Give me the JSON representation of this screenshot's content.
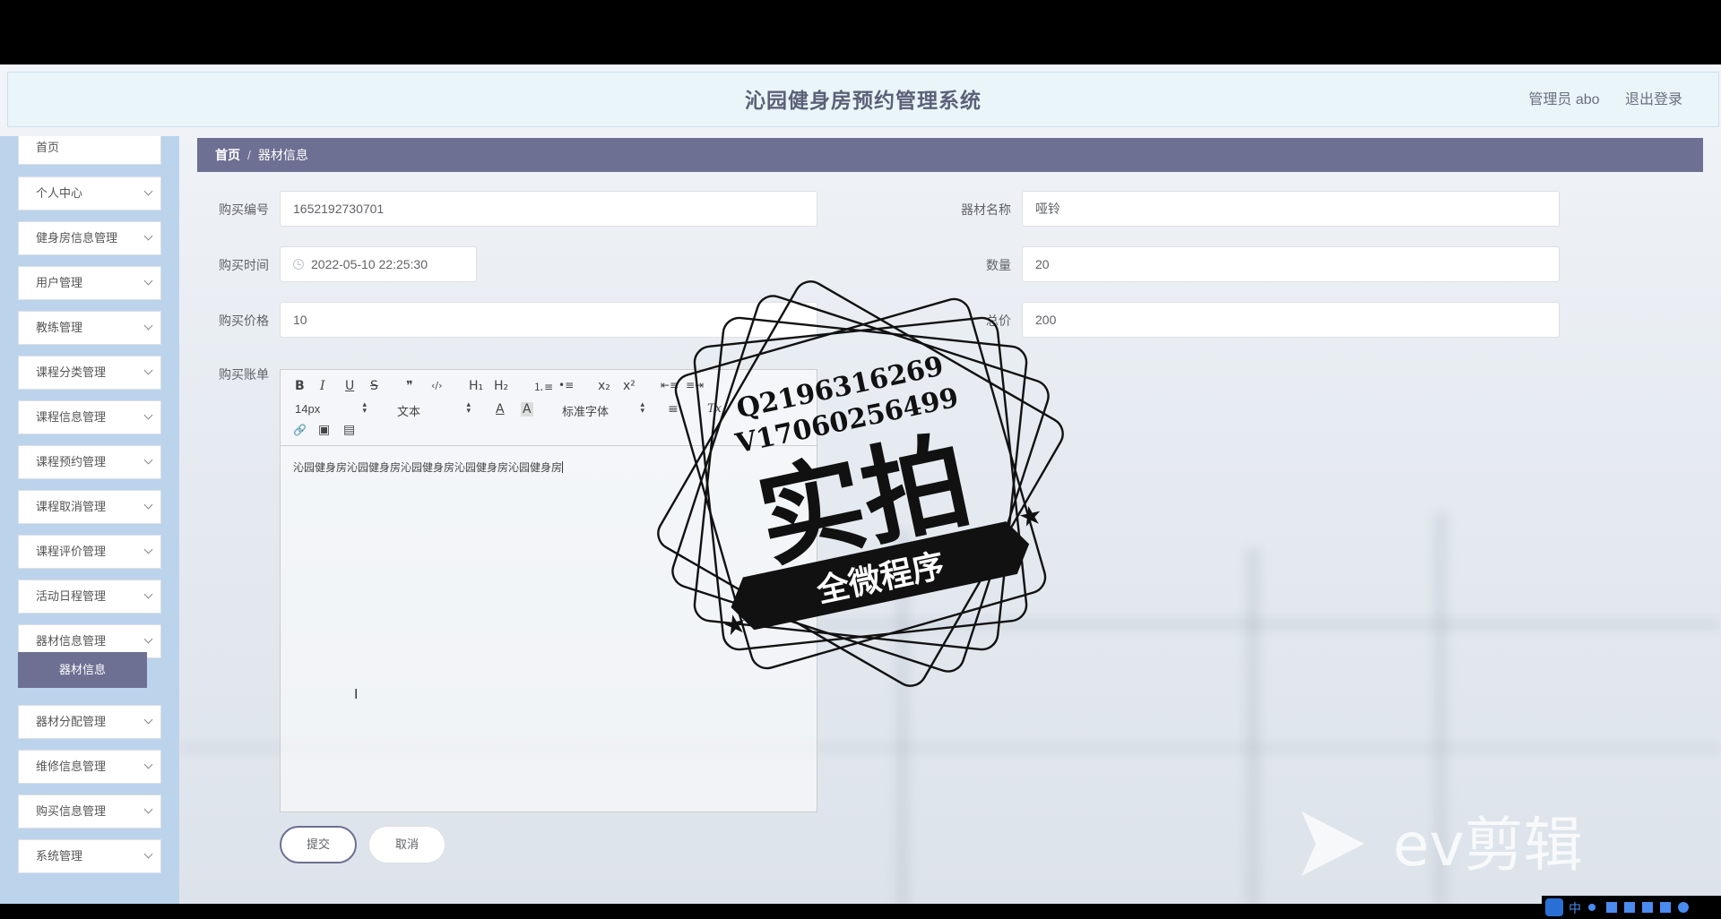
{
  "header": {
    "title": "沁园健身房预约管理系统",
    "user": "管理员 abo",
    "logout": "退出登录"
  },
  "sidebar": {
    "partial_top": "首页",
    "items": [
      {
        "label": "个人中心"
      },
      {
        "label": "健身房信息管理"
      },
      {
        "label": "用户管理"
      },
      {
        "label": "教练管理"
      },
      {
        "label": "课程分类管理"
      },
      {
        "label": "课程信息管理"
      },
      {
        "label": "课程预约管理"
      },
      {
        "label": "课程取消管理"
      },
      {
        "label": "课程评价管理"
      },
      {
        "label": "活动日程管理"
      },
      {
        "label": "器材信息管理"
      },
      {
        "label": "器材分配管理"
      },
      {
        "label": "维修信息管理"
      },
      {
        "label": "购买信息管理"
      },
      {
        "label": "系统管理"
      }
    ],
    "active_sub": "器材信息"
  },
  "breadcrumb": {
    "home": "首页",
    "sep": "/",
    "current": "器材信息"
  },
  "form": {
    "purchase_no": {
      "label": "购买编号",
      "value": "1652192730701"
    },
    "equipment_name": {
      "label": "器材名称",
      "value": "哑铃"
    },
    "purchase_time": {
      "label": "购买时间",
      "value": "2022-05-10 22:25:30"
    },
    "quantity": {
      "label": "数量",
      "value": "20"
    },
    "price": {
      "label": "购买价格",
      "value": "10"
    },
    "total": {
      "label": "总价",
      "value": "200"
    },
    "bill": {
      "label": "购买账单"
    }
  },
  "editor": {
    "toolbar": {
      "bold": "B",
      "italic": "I",
      "underline": "U",
      "strike": "S",
      "quote": "❞",
      "code": "‹/›",
      "h1": "H₁",
      "h2": "H₂",
      "ol": "⒈≡",
      "ul": "•≡",
      "sub": "x₂",
      "sup": "x²",
      "outdent": "⇤≡",
      "indent": "≡⇥",
      "size": "14px",
      "header": "文本",
      "font": "标准字体",
      "color": "A",
      "bg": "A",
      "align": "≡",
      "clean": "Tx",
      "link": "🔗",
      "image": "▣",
      "video": "▤"
    },
    "content": "沁园健身房沁园健身房沁园健身房沁园健身房沁园健身房"
  },
  "buttons": {
    "submit": "提交",
    "cancel": "取消"
  },
  "watermark": {
    "qq": "Q2196316269",
    "vx": "V17060256499",
    "big": "实拍",
    "ribbon": "全微程序",
    "ev": "ev剪辑"
  },
  "ime": {
    "label": "中"
  }
}
